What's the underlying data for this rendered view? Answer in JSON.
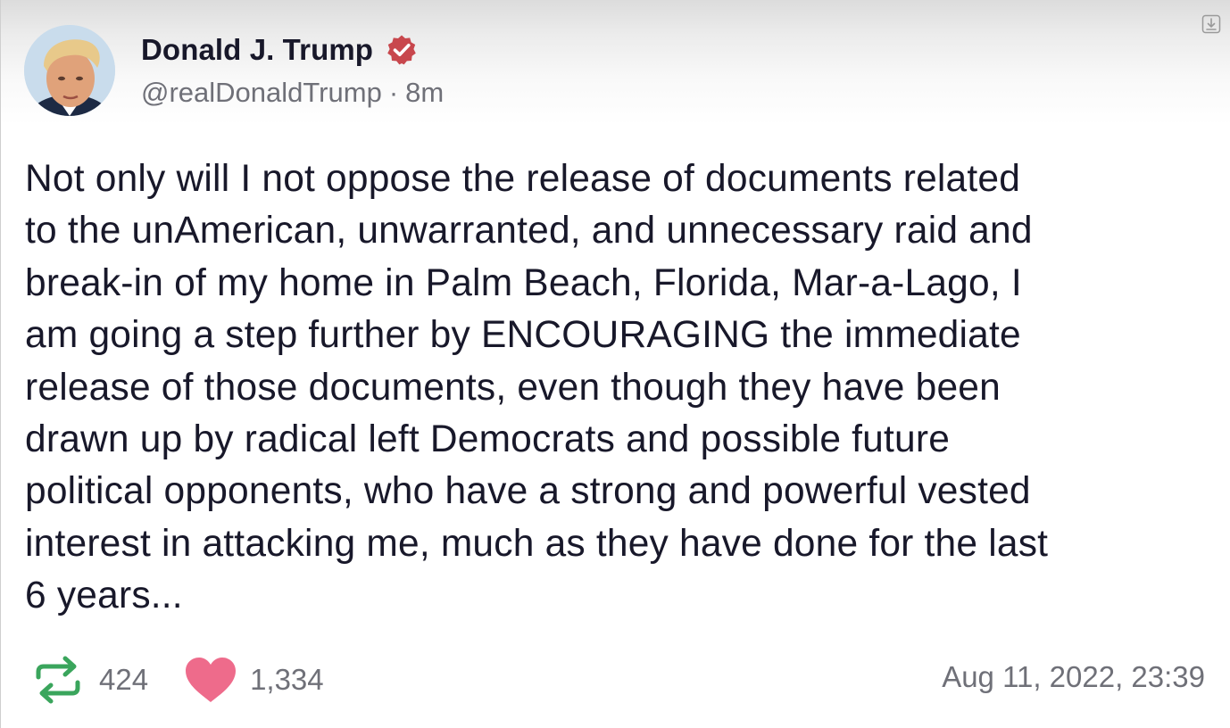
{
  "author": {
    "display_name": "Donald J. Trump",
    "handle": "@realDonaldTrump",
    "relative_time": "8m",
    "separator": "·",
    "verified_color": "#c8474d"
  },
  "post": {
    "text": "Not only will I not oppose the release of documents related\nto the unAmerican, unwarranted, and unnecessary raid and\nbreak-in of my home in Palm Beach, Florida, Mar-a-Lago, I\nam going a step further by ENCOURAGING the immediate\nrelease of those documents, even though they have been\ndrawn up by radical left Democrats and possible future\npolitical opponents, who have a strong and powerful vested\ninterest in attacking me, much as they have done for the last\n6 years..."
  },
  "engagement": {
    "repost_count": "424",
    "like_count": "1,334",
    "repost_color": "#3aa55c",
    "like_color": "#ee6b8b"
  },
  "timestamp": "Aug 11, 2022, 23:39",
  "icons": {
    "avatar": "profile-photo",
    "verified": "verified-badge-icon",
    "repost": "repost-icon",
    "like": "heart-icon",
    "corner": "download-icon"
  }
}
